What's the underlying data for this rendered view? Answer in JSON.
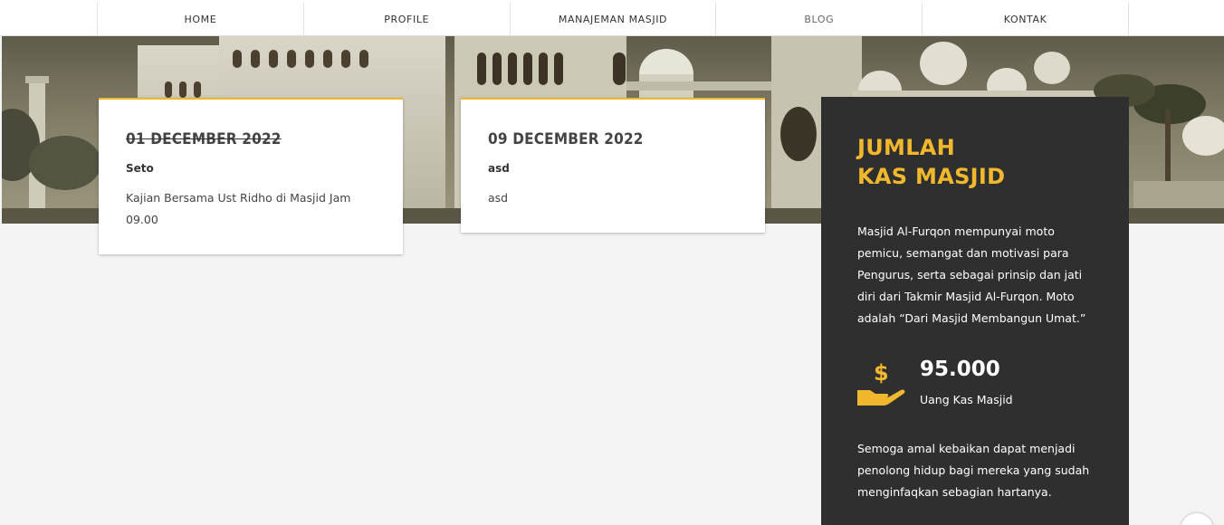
{
  "nav": {
    "items": [
      {
        "label": "HOME"
      },
      {
        "label": "PROFILE"
      },
      {
        "label": "MANAJEMAN MASJID"
      },
      {
        "label": "BLOG"
      },
      {
        "label": "KONTAK"
      }
    ]
  },
  "events": [
    {
      "date": "01 DECEMBER 2022",
      "name": "Seto",
      "description": "Kajian Bersama Ust Ridho di Masjid Jam 09.00"
    },
    {
      "date": "09 DECEMBER 2022",
      "name": "asd",
      "description": "asd"
    }
  ],
  "panel": {
    "title_line1": "JUMLAH",
    "title_line2": "KAS MASJID",
    "intro": "Masjid Al-Furqon mempunyai moto pemicu, semangat dan motivasi para Pengurus, serta sebagai prinsip dan jati diri dari Takmir Masjid Al-Furqon. Moto adalah “Dari Masjid Membangun Umat.”",
    "amount": "95.000",
    "amount_label": "Uang Kas Masjid",
    "closing": "Semoga amal kebaikan dapat menjadi penolong hidup bagi mereka yang sudah menginfaqkan sebagian hartanya.",
    "icon": "hand-dollar-icon"
  },
  "colors": {
    "accent": "#f1b82d",
    "panel_bg": "#2f2f2f",
    "page_bg": "#f4f4f4"
  }
}
